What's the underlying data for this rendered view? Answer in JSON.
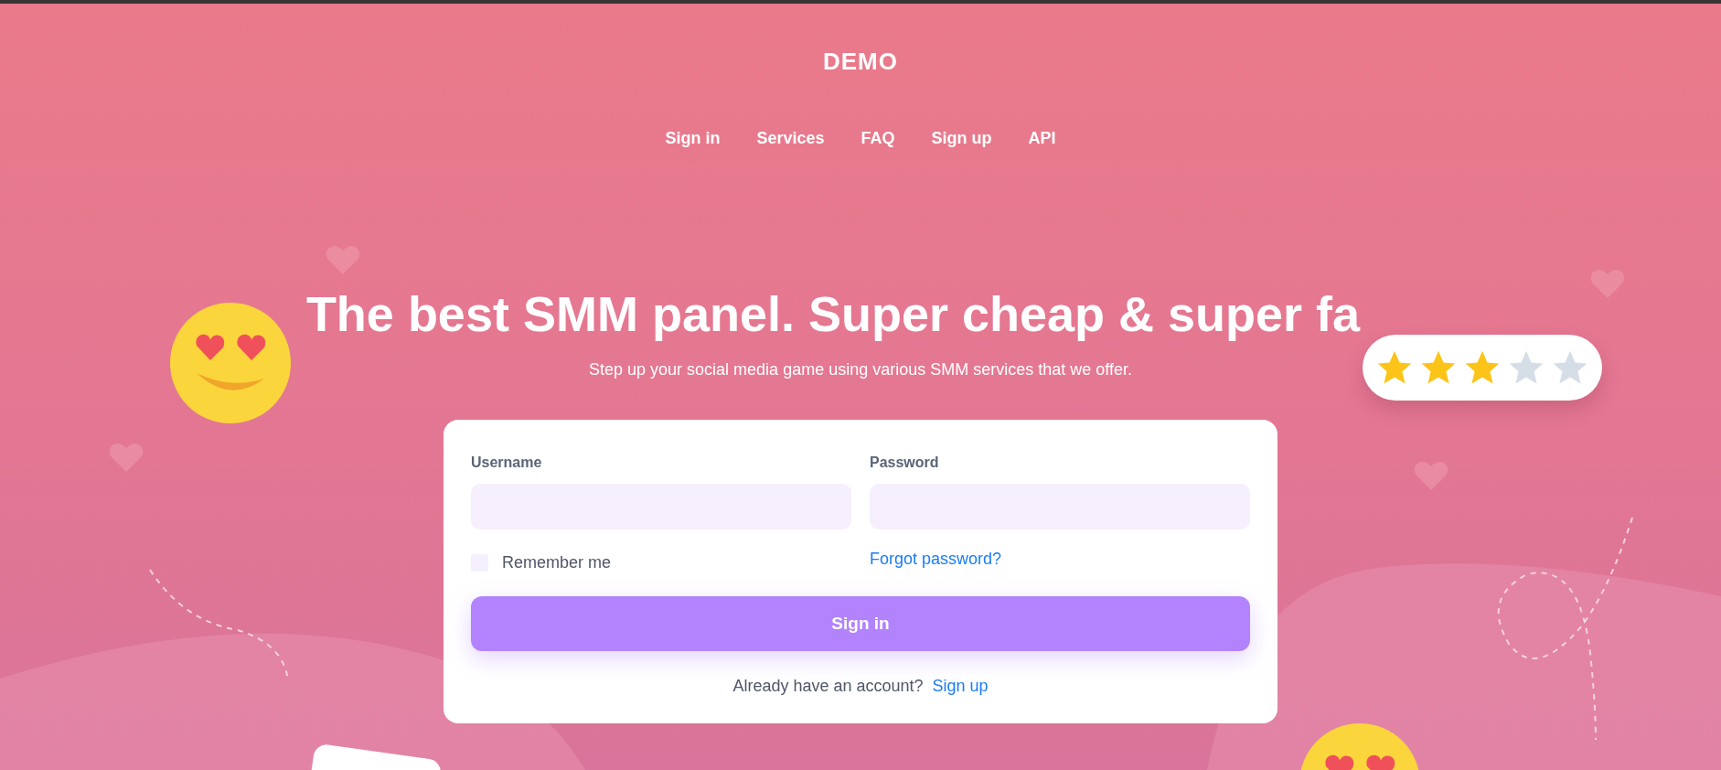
{
  "brand": "DEMO",
  "nav": [
    {
      "label": "Sign in"
    },
    {
      "label": "Services"
    },
    {
      "label": "FAQ"
    },
    {
      "label": "Sign up"
    },
    {
      "label": "API"
    }
  ],
  "hero": {
    "title": "The best SMM panel. Super cheap & super fa",
    "subtitle": "Step up your social media game using various SMM services that we offer.",
    "rating": {
      "stars": 3
    }
  },
  "form": {
    "username_label": "Username",
    "password_label": "Password",
    "remember": {
      "label": "Remember me",
      "checked": false
    },
    "forgot": "Forgot password?",
    "submit": "Sign in",
    "signup_prompt": "Already have an account?",
    "signup_link": "Sign up"
  }
}
